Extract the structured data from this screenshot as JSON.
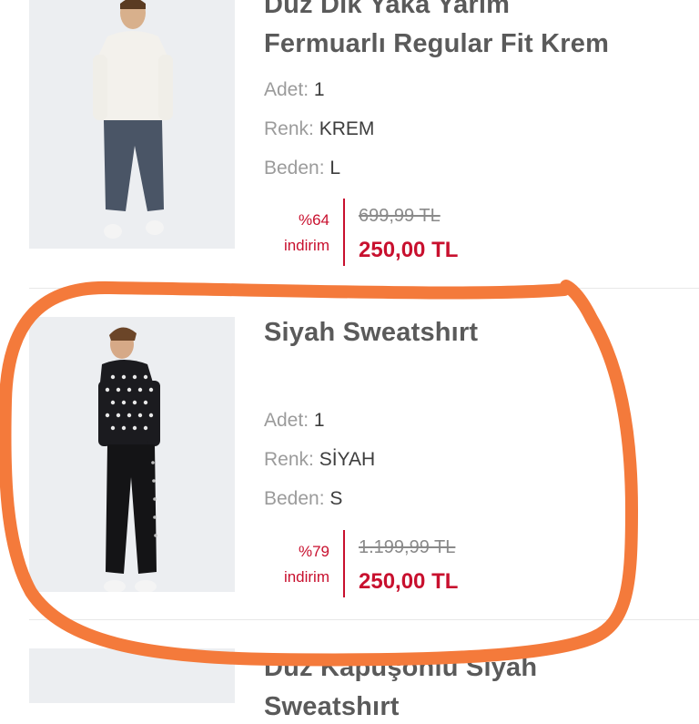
{
  "cart_items": [
    {
      "title_lines": [
        "Düz Dik Yaka Yarım",
        "Fermuarlı Regular Fit Krem"
      ],
      "qty_label": "Adet:",
      "qty": "1",
      "color_label": "Renk:",
      "color": "KREM",
      "size_label": "Beden:",
      "size": "L",
      "discount_pct": "%64",
      "discount_word": "indirim",
      "old_price": "699,99 TL",
      "new_price": "250,00 TL"
    },
    {
      "title_lines": [
        "Siyah Sweatshırt"
      ],
      "qty_label": "Adet:",
      "qty": "1",
      "color_label": "Renk:",
      "color": "SİYAH",
      "size_label": "Beden:",
      "size": "S",
      "discount_pct": "%79",
      "discount_word": "indirim",
      "old_price": "1.199,99 TL",
      "new_price": "250,00 TL"
    },
    {
      "title_lines": [
        "Düz Kapüşonlu Siyah",
        "Sweatshırt"
      ]
    }
  ],
  "colors": {
    "sale_red": "#c8102e",
    "annotation_orange": "#f47a3b",
    "thumb_bg": "#eceef1"
  }
}
